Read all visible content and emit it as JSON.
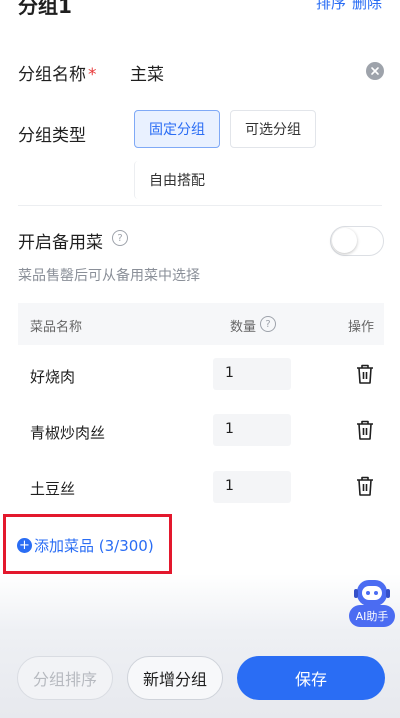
{
  "header": {
    "title": "分组1",
    "sort_link": "排序",
    "delete_link": "删除"
  },
  "form": {
    "name_label": "分组名称",
    "required_mark": "*",
    "name_value": "主菜",
    "type_label": "分组类型",
    "type_options": [
      "固定分组",
      "可选分组",
      "自由搭配"
    ],
    "type_selected": "固定分组",
    "backup_label": "开启备用菜",
    "backup_enabled": false,
    "backup_hint": "菜品售罄后可从备用菜中选择"
  },
  "table": {
    "col_name": "菜品名称",
    "col_qty": "数量",
    "col_action": "操作",
    "rows": [
      {
        "name": "好烧肉",
        "qty": "1"
      },
      {
        "name": "青椒炒肉丝",
        "qty": "1"
      },
      {
        "name": "土豆丝",
        "qty": "1"
      }
    ]
  },
  "add_dish": {
    "plus": "+",
    "label": "添加菜品 (3/300)"
  },
  "assistant": {
    "label": "AI助手"
  },
  "footer": {
    "sort_button": "分组排序",
    "add_group_button": "新增分组",
    "save_button": "保存"
  },
  "colors": {
    "primary": "#2a6df4",
    "danger": "#e3182d",
    "required": "#e8393a"
  }
}
